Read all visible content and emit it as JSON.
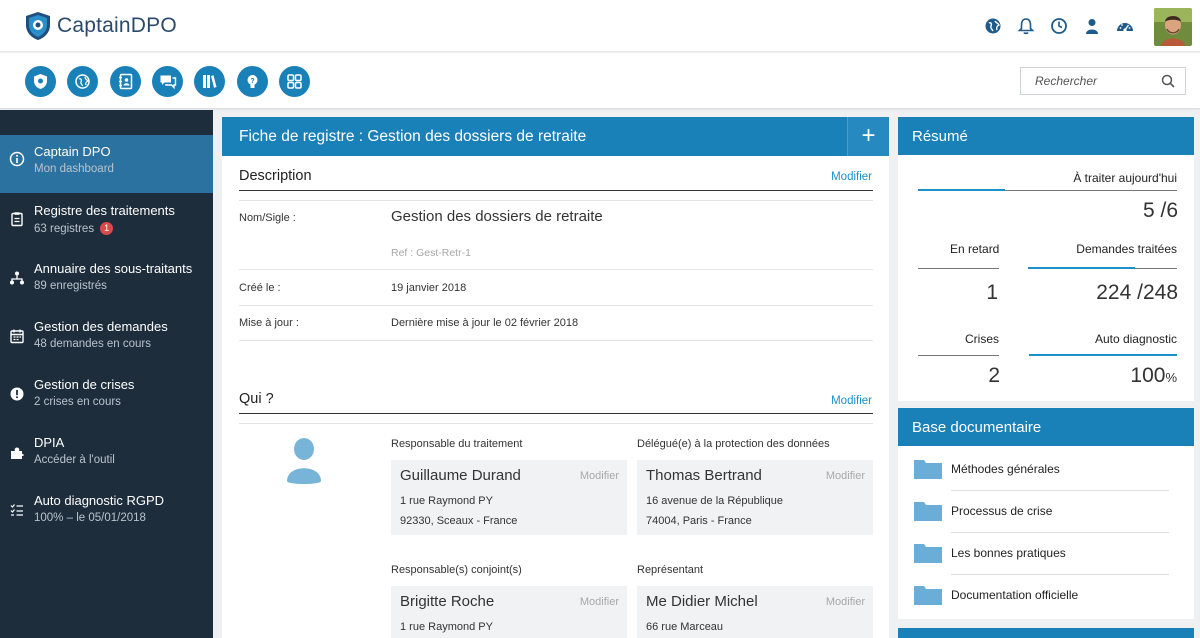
{
  "app": {
    "name": "CaptainDPO"
  },
  "header": {
    "icons": [
      "globe-icon",
      "bell-icon",
      "clock-icon",
      "user-icon",
      "dashboard-icon"
    ]
  },
  "toolbar": {
    "buttons": [
      "shield-icon",
      "globe-icon",
      "address-book-icon",
      "chat-icon",
      "books-icon",
      "lightbulb-icon",
      "grid-icon"
    ],
    "search_placeholder": "Rechercher"
  },
  "sidebar": {
    "items": [
      {
        "title": "Captain DPO",
        "sub": "Mon dashboard",
        "icon": "info-icon"
      },
      {
        "title": "Registre des traitements",
        "sub": "63 registres",
        "badge": "1",
        "icon": "clipboard-icon"
      },
      {
        "title": "Annuaire des sous-traitants",
        "sub": "89 enregistrés",
        "icon": "network-icon"
      },
      {
        "title": "Gestion des demandes",
        "sub": "48 demandes en cours",
        "icon": "calendar-icon"
      },
      {
        "title": "Gestion de crises",
        "sub": "2 crises en cours",
        "icon": "alert-icon"
      },
      {
        "title": "DPIA",
        "sub": "Accéder à l'outil",
        "icon": "puzzle-icon"
      },
      {
        "title": "Auto diagnostic RGPD",
        "sub": "100% – le 05/01/2018",
        "icon": "checklist-icon"
      }
    ]
  },
  "main": {
    "title": "Fiche de registre : Gestion des dossiers de retraite",
    "plus": "+",
    "description": {
      "heading": "Description",
      "modify": "Modifier",
      "nom_label": "Nom/Sigle :",
      "nom_value": "Gestion des dossiers de retraite",
      "ref": "Ref : Gest-Retr-1",
      "cree_label": "Créé le :",
      "cree_value": "19 janvier 2018",
      "maj_label": "Mise à jour :",
      "maj_value": "Dernière mise à jour le 02 février 2018"
    },
    "qui": {
      "heading": "Qui ?",
      "modify": "Modifier",
      "cards": [
        {
          "caption": "Responsable du traitement",
          "name": "Guillaume Durand",
          "modify": "Modifier",
          "line1": "1 rue Raymond PY",
          "line2": "92330, Sceaux - France"
        },
        {
          "caption": "Délégué(e) à la protection des données",
          "name": "Thomas Bertrand",
          "modify": "Modifier",
          "line1": "16 avenue de la République",
          "line2": "74004, Paris - France"
        },
        {
          "caption": "Responsable(s) conjoint(s)",
          "name": "Brigitte Roche",
          "modify": "Modifier",
          "line1": "1 rue Raymond PY",
          "line2": ""
        },
        {
          "caption": "Représentant",
          "name": "Me Didier Michel",
          "modify": "Modifier",
          "line1": "66 rue Marceau",
          "line2": ""
        }
      ]
    }
  },
  "resume": {
    "title": "Résumé",
    "today_label": "À traiter aujourd'hui",
    "today_value": "5 /6",
    "late_label": "En retard",
    "late_value": "1",
    "handled_label": "Demandes traitées",
    "handled_value": "224 /248",
    "crises_label": "Crises",
    "crises_value": "2",
    "diag_label": "Auto diagnostic",
    "diag_value": "100",
    "diag_unit": "%"
  },
  "base": {
    "title": "Base documentaire",
    "items": [
      "Méthodes générales",
      "Processus de crise",
      "Les bonnes pratiques",
      "Documentation officielle"
    ]
  },
  "colors": {
    "primary": "#1a80b8",
    "sidebar": "#1e2d3c",
    "sidebar_active": "#2b72a0",
    "link": "#1a91c8",
    "badge": "#d94b4b"
  }
}
